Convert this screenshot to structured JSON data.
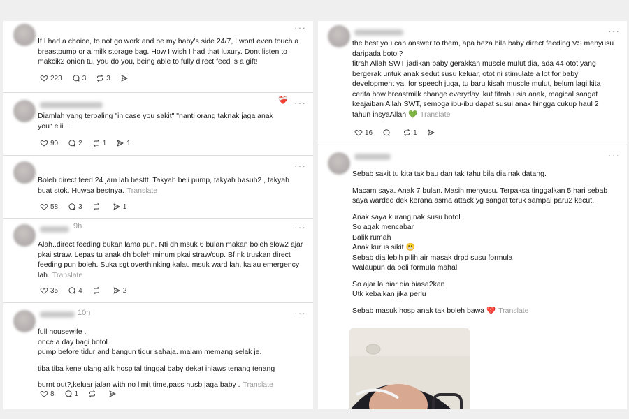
{
  "left_posts": [
    {
      "time": "",
      "lines": [
        "If I had a choice, to not go work and be my baby's side 24/7, I wont even touch a",
        "breastpump or a milk storage bag. How I wish I had that luxury. Dont listen to",
        "makcik2 onion tu, you do you, being able to fully direct feed is a gift!"
      ],
      "translate": "",
      "likes": "223",
      "replies": "3",
      "reposts": "3",
      "shares": ""
    },
    {
      "time": "",
      "lines": [
        "Diamlah yang terpaling \"in case you sakit\" \"nanti orang taknak jaga anak",
        "you\" eiii..."
      ],
      "translate": "",
      "likes": "90",
      "replies": "2",
      "reposts": "1",
      "shares": "1"
    },
    {
      "time": "",
      "lines": [
        "Boleh direct feed 24 jam lah besttt. Takyah beli pump, takyah basuh2 , takyah",
        "buat stok. Huwaa bestnya."
      ],
      "translate": "Translate",
      "likes": "58",
      "replies": "3",
      "reposts": "",
      "shares": "1"
    },
    {
      "time": "9h",
      "lines": [
        "Alah..direct feeding bukan lama pun. Nti dh msuk 6 bulan makan boleh slow2 ajar",
        "pkai straw. Lepas tu anak dh boleh minum pkai straw/cup. Bf nk truskan direct",
        "feeding pun boleh. Suka sgt overthinking kalau msuk ward lah, kalau emergency",
        "lah."
      ],
      "translate": "Translate",
      "likes": "35",
      "replies": "4",
      "reposts": "",
      "shares": "2"
    },
    {
      "time": "10h",
      "lines": [
        "full housewife .",
        "once a day bagi botol",
        "pump before tidur and bangun tidur sahaja. malam memang selak je.",
        "tiba tiba kene ulang alik hospital,tinggal baby dekat inlaws tenang tenang",
        "burnt out?,keluar jalan with no limit time,pass husb jaga baby ."
      ],
      "translate": "Translate",
      "likes": "8",
      "replies": "1",
      "reposts": "",
      "shares": ""
    }
  ],
  "right_posts": [
    {
      "time": "",
      "lines": [
        "the best you can answer to them, apa beza bila baby direct feeding VS menyusu",
        "daripada botol?",
        "fitrah Allah SWT jadikan baby gerakkan muscle mulut dia, ada 44 otot yang",
        "bergerak untuk anak sedut susu keluar, otot ni stimulate a lot for baby",
        "development ya, for speech juga, tu baru kisah muscle mulut, belum lagi kita",
        "cerita how breastmilk change everyday ikut fitrah usia anak, magical sangat",
        "keajaiban Allah SWT, semoga ibu-ibu dapat susui anak hingga cukup haul 2",
        "tahun insyaAllah 💚"
      ],
      "translate": "Translate",
      "likes": "16",
      "replies": "",
      "reposts": "1",
      "shares": ""
    },
    {
      "time": "",
      "lines": [
        "Sebab sakit tu kita tak bau dan tak tahu bila dia nak datang.",
        "Macam saya. Anak 7 bulan. Masih menyusu. Terpaksa tinggalkan 5 hari sebab",
        "saya warded dek kerana asma attack yg sangat teruk sampai paru2 kecut.",
        "Anak saya kurang nak susu botol",
        "So agak mencabar",
        "Balik rumah",
        "Anak kurus sikit 😬",
        "Sebab dia lebih pilih air masak drpd susu formula",
        "Walaupun da beli formula mahal",
        "So ajar la biar dia biasa2kan",
        "Utk kebaikan jika perlu",
        "Sebab masuk hosp anak tak boleh bawa 💔"
      ],
      "translate": "Translate",
      "likes": "",
      "replies": "",
      "reposts": "",
      "shares": ""
    }
  ],
  "icons": {
    "more": "more-dots-icon",
    "like": "heart-icon",
    "reply": "comment-icon",
    "repost": "repost-icon",
    "share": "share-icon"
  },
  "colors": {
    "background": "#efefef",
    "panel": "#ffffff",
    "muted": "#9b9b9b",
    "divider": "#dcdcdc"
  }
}
